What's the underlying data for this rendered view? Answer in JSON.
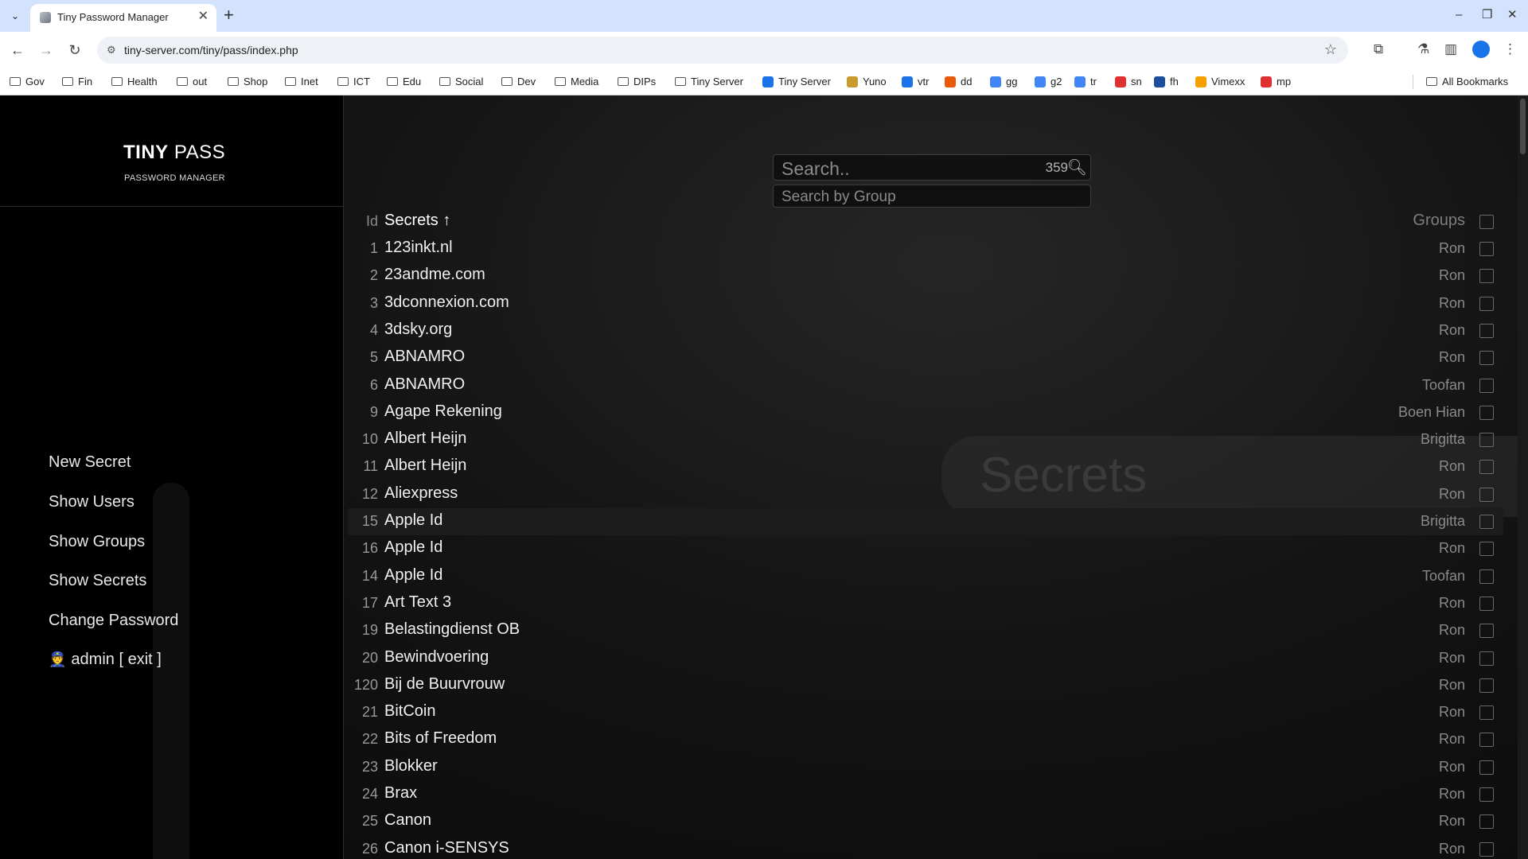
{
  "browser": {
    "tab_title": "Tiny Password Manager",
    "url": "tiny-server.com/tiny/pass/index.php",
    "bookmarks": [
      {
        "label": "Gov",
        "kind": "folder"
      },
      {
        "label": "Fin",
        "kind": "folder"
      },
      {
        "label": "Health",
        "kind": "folder"
      },
      {
        "label": "out",
        "kind": "folder"
      },
      {
        "label": "Shop",
        "kind": "folder"
      },
      {
        "label": "Inet",
        "kind": "folder"
      },
      {
        "label": "ICT",
        "kind": "folder"
      },
      {
        "label": "Edu",
        "kind": "folder"
      },
      {
        "label": "Social",
        "kind": "folder"
      },
      {
        "label": "Dev",
        "kind": "folder"
      },
      {
        "label": "Media",
        "kind": "folder"
      },
      {
        "label": "DIPs",
        "kind": "folder"
      },
      {
        "label": "Tiny Server",
        "kind": "folder"
      },
      {
        "label": "Tiny Server",
        "kind": "site",
        "color": "#1a73e8"
      },
      {
        "label": "Yuno",
        "kind": "site",
        "color": "#c99a2e"
      },
      {
        "label": "vtr",
        "kind": "site",
        "color": "#1a73e8"
      },
      {
        "label": "dd",
        "kind": "site",
        "color": "#e8590c"
      },
      {
        "label": "gg",
        "kind": "site",
        "color": "#4285f4"
      },
      {
        "label": "g2",
        "kind": "site",
        "color": "#4285f4"
      },
      {
        "label": "tr",
        "kind": "site",
        "color": "#4285f4"
      },
      {
        "label": "sn",
        "kind": "site",
        "color": "#e03131"
      },
      {
        "label": "fh",
        "kind": "site",
        "color": "#1c4e9c"
      },
      {
        "label": "Vimexx",
        "kind": "site",
        "color": "#f59f00"
      },
      {
        "label": "mp",
        "kind": "site",
        "color": "#e03131"
      }
    ],
    "all_bookmarks": "All Bookmarks"
  },
  "app": {
    "brand_bold": "TINY",
    "brand_light": "PASS",
    "brand_sub": "PASSWORD MANAGER",
    "menu": {
      "new_secret": "New Secret",
      "show_users": "Show Users",
      "show_groups": "Show Groups",
      "show_secrets": "Show Secrets",
      "change_password": "Change Password",
      "user_icon": "👮",
      "user_text": "admin [ exit ]"
    },
    "search": {
      "placeholder": "Search..",
      "count": "359",
      "group_placeholder": "Search by Group"
    },
    "watermark": "Secrets",
    "table": {
      "col_id": "Id",
      "col_secrets": "Secrets ↑",
      "col_groups": "Groups",
      "rows": [
        {
          "id": "1",
          "name": "123inkt.nl",
          "group": "Ron"
        },
        {
          "id": "2",
          "name": "23andme.com",
          "group": "Ron"
        },
        {
          "id": "3",
          "name": "3dconnexion.com",
          "group": "Ron"
        },
        {
          "id": "4",
          "name": "3dsky.org",
          "group": "Ron"
        },
        {
          "id": "5",
          "name": "ABNAMRO",
          "group": "Ron"
        },
        {
          "id": "6",
          "name": "ABNAMRO",
          "group": "Toofan"
        },
        {
          "id": "9",
          "name": "Agape Rekening",
          "group": "Boen Hian"
        },
        {
          "id": "10",
          "name": "Albert Heijn",
          "group": "Brigitta"
        },
        {
          "id": "11",
          "name": "Albert Heijn",
          "group": "Ron"
        },
        {
          "id": "12",
          "name": "Aliexpress",
          "group": "Ron"
        },
        {
          "id": "15",
          "name": "Apple Id",
          "group": "Brigitta"
        },
        {
          "id": "16",
          "name": "Apple Id",
          "group": "Ron"
        },
        {
          "id": "14",
          "name": "Apple Id",
          "group": "Toofan"
        },
        {
          "id": "17",
          "name": "Art Text 3",
          "group": "Ron"
        },
        {
          "id": "19",
          "name": "Belastingdienst OB",
          "group": "Ron"
        },
        {
          "id": "20",
          "name": "Bewindvoering",
          "group": "Ron"
        },
        {
          "id": "120",
          "name": "Bij de Buurvrouw",
          "group": "Ron"
        },
        {
          "id": "21",
          "name": "BitCoin",
          "group": "Ron"
        },
        {
          "id": "22",
          "name": "Bits of Freedom",
          "group": "Ron"
        },
        {
          "id": "23",
          "name": "Blokker",
          "group": "Ron"
        },
        {
          "id": "24",
          "name": "Brax",
          "group": "Ron"
        },
        {
          "id": "25",
          "name": "Canon",
          "group": "Ron"
        },
        {
          "id": "26",
          "name": "Canon i-SENSYS",
          "group": "Ron"
        }
      ]
    }
  }
}
